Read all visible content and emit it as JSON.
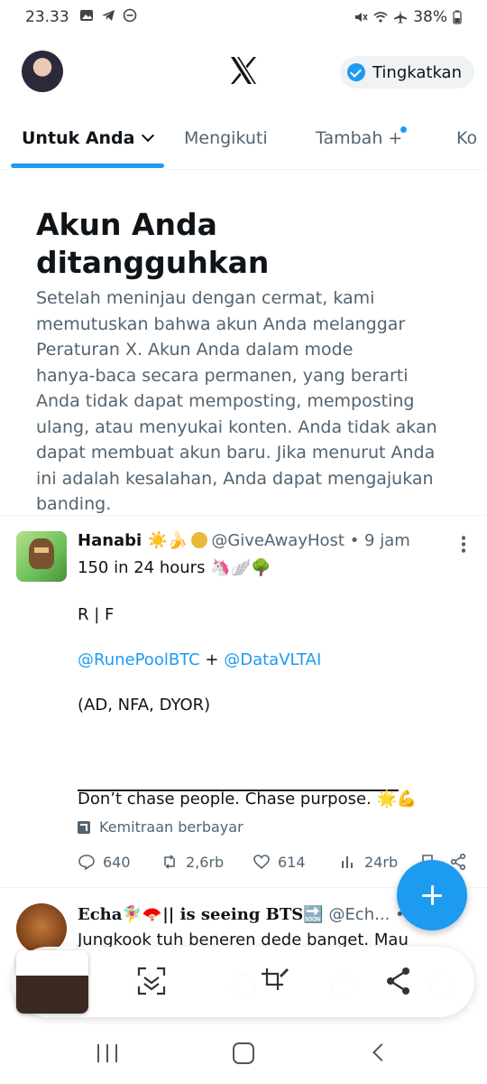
{
  "status_bar": {
    "time": "23.33",
    "battery": "38%"
  },
  "header": {
    "upgrade_label": "Tingkatkan"
  },
  "tabs": [
    {
      "label": "Untuk Anda"
    },
    {
      "label": "Mengikuti"
    },
    {
      "label": "Tambah +"
    },
    {
      "label": "Ko"
    }
  ],
  "notice": {
    "title": "Akun Anda ditangguhkan",
    "lines": [
      "Setelah meninjau dengan cermat, kami",
      "memutuskan bahwa akun Anda melanggar",
      "Peraturan X. Akun Anda dalam mode",
      "hanya-baca secara permanen, yang berarti",
      "Anda tidak dapat memposting, memposting",
      "ulang, atau menyukai konten. Anda tidak akan",
      "dapat membuat akun baru. Jika menurut Anda",
      "ini adalah kesalahan, Anda dapat mengajukan",
      "banding."
    ]
  },
  "tweet": {
    "name": "Hanabi ☀️🍌",
    "handle_time": "@GiveAwayHost • 9 jam",
    "line1": "150 in 24 hours 🦄🪽🌳",
    "line2": "R | F",
    "mention1": "@RunePoolBTC",
    "plus": " + ",
    "mention2": "@DataVLTAI",
    "line4": "(AD, NFA, DYOR)",
    "line5": "Don’t chase people. Chase purpose. 🌟💪",
    "paid_label": "Kemitraan berbayar",
    "replies": "640",
    "reposts": "2,6rb",
    "likes": "614",
    "views": "24rb"
  },
  "tweet2": {
    "name": "Echa🧚‍♀️🪭|| is seeing BTS🔜",
    "handle_time": "@Ech...  • 10 j",
    "text": "Jungkook tuh beneren dede banget. Mau"
  },
  "colors": {
    "accent": "#1d9bf0",
    "text": "#0f1419",
    "secondary": "#536471"
  }
}
